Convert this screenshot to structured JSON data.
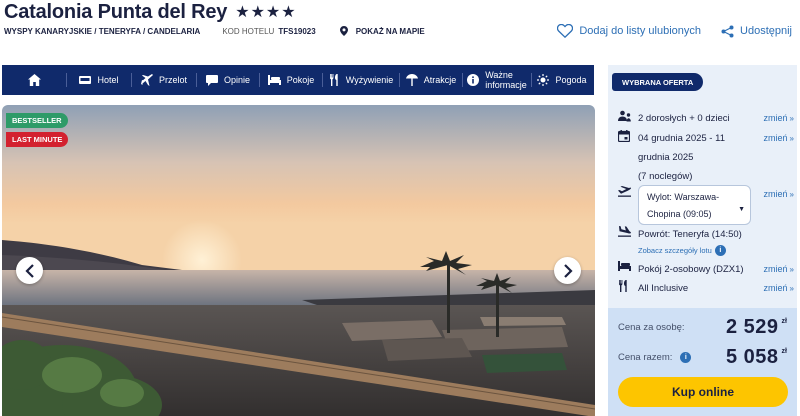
{
  "header": {
    "hotel_name": "Catalonia Punta del Rey",
    "stars": "★★★★",
    "location": "WYSPY KANARYJSKIE / TENERYFA / CANDELARIA",
    "code_label": "KOD HOTELU",
    "code": "TFS19023",
    "map_link": "POKAŻ NA MAPIE",
    "favorite_label": "Dodaj do listy ulubionych",
    "share_label": "Udostępnij"
  },
  "nav": {
    "home_icon": "home-icon",
    "items": [
      {
        "label": "Hotel",
        "icon": "bed-icon"
      },
      {
        "label": "Przelot",
        "icon": "plane-icon"
      },
      {
        "label": "Opinie",
        "icon": "comment-icon"
      },
      {
        "label": "Pokoje",
        "icon": "bed-icon"
      },
      {
        "label": "Wyżywienie",
        "icon": "cutlery-icon"
      },
      {
        "label": "Atrakcje",
        "icon": "deckchair-icon"
      },
      {
        "label": "Ważne",
        "label2": "informacje",
        "icon": "info-icon"
      },
      {
        "label": "Pogoda",
        "icon": "sun-icon"
      }
    ]
  },
  "gallery": {
    "badge_bestseller": "BESTSELLER",
    "badge_last_minute": "LAST MINUTE",
    "prev_icon": "chevron-left-icon",
    "next_icon": "chevron-right-icon"
  },
  "offer": {
    "tag": "WYBRANA OFERTA",
    "change_label": "zmień",
    "travellers": "2 dorosłych + 0 dzieci",
    "dates_line1": "04 grudnia 2025 - 11",
    "dates_line2": "grudnia 2025",
    "nights": "(7 noclegów)",
    "departure_line1": "Wylot: Warszawa-",
    "departure_line2": "Chopina (09:05)",
    "return": "Powrót: Teneryfa (14:50)",
    "flight_details": "Zobacz szczegóły lotu",
    "room": "Pokój 2-osobowy (DZX1)",
    "board": "All Inclusive",
    "price_per_person_label": "Cena za osobę:",
    "price_per_person": "2 529",
    "price_total_label": "Cena razem:",
    "price_total": "5 058",
    "currency": "zł",
    "book_button": "Kup online"
  },
  "colors": {
    "navy": "#102a6b",
    "link": "#2d6fb5",
    "cta": "#fdc500",
    "bestseller": "#2e9b68",
    "last_minute": "#d3212f"
  }
}
